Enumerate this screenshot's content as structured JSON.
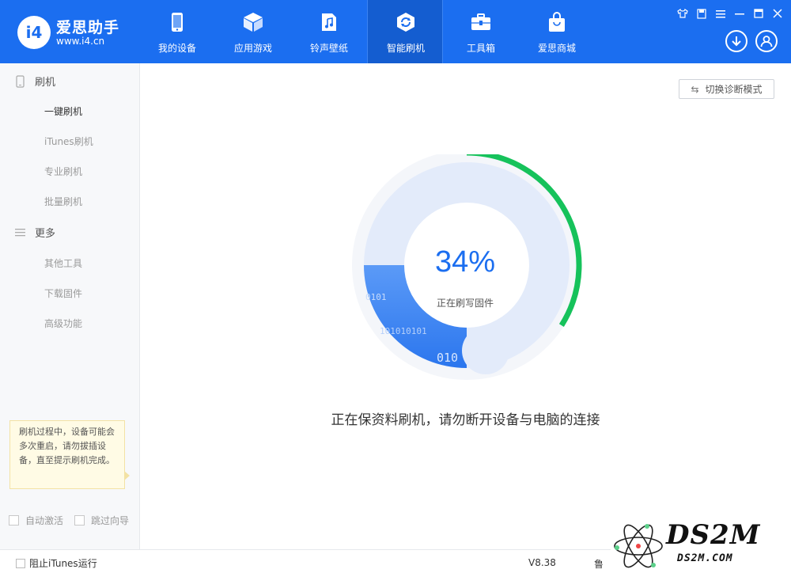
{
  "brand": {
    "logo_text": "i4",
    "name": "爱思助手",
    "url": "www.i4.cn"
  },
  "nav": [
    {
      "label": "我的设备",
      "icon": "phone-icon"
    },
    {
      "label": "应用游戏",
      "icon": "cube-icon"
    },
    {
      "label": "铃声壁纸",
      "icon": "music-file-icon"
    },
    {
      "label": "智能刷机",
      "icon": "refresh-shield-icon",
      "active": true
    },
    {
      "label": "工具箱",
      "icon": "toolbox-icon"
    },
    {
      "label": "爱思商城",
      "icon": "shopping-bag-icon"
    }
  ],
  "window_controls": [
    "shirt-icon",
    "note-icon",
    "menu-icon",
    "minimize-icon",
    "maximize-icon",
    "close-icon"
  ],
  "sidebar": {
    "groups": [
      {
        "title": "刷机",
        "icon": "phone-outline-icon",
        "items": [
          "一键刷机",
          "iTunes刷机",
          "专业刷机",
          "批量刷机"
        ],
        "active_index": 0
      },
      {
        "title": "更多",
        "icon": "list-icon",
        "items": [
          "其他工具",
          "下载固件",
          "高级功能"
        ]
      }
    ],
    "tip": "刷机过程中，设备可能会多次重启，请勿拔插设备，直至提示刷机完成。",
    "checkboxes": [
      "自动激活",
      "跳过向导"
    ]
  },
  "diag_button": "切换诊断模式",
  "progress": {
    "percent_text": "34%",
    "value": 0.34,
    "status": "正在刷写固件",
    "binary_texts": [
      "0101",
      "101010101",
      "010"
    ]
  },
  "message": "正在保资料刷机，请勿断开设备与电脑的连接",
  "statusbar": {
    "checkbox_label": "阻止iTunes运行",
    "version": "V8.38",
    "extra": "鲁"
  },
  "watermark": {
    "big": "DS2M",
    "small": "DS2M.COM"
  },
  "colors": {
    "brand_blue": "#1b6ef0",
    "progress_green": "#16c25b",
    "ring_light": "#e3ebfa"
  }
}
